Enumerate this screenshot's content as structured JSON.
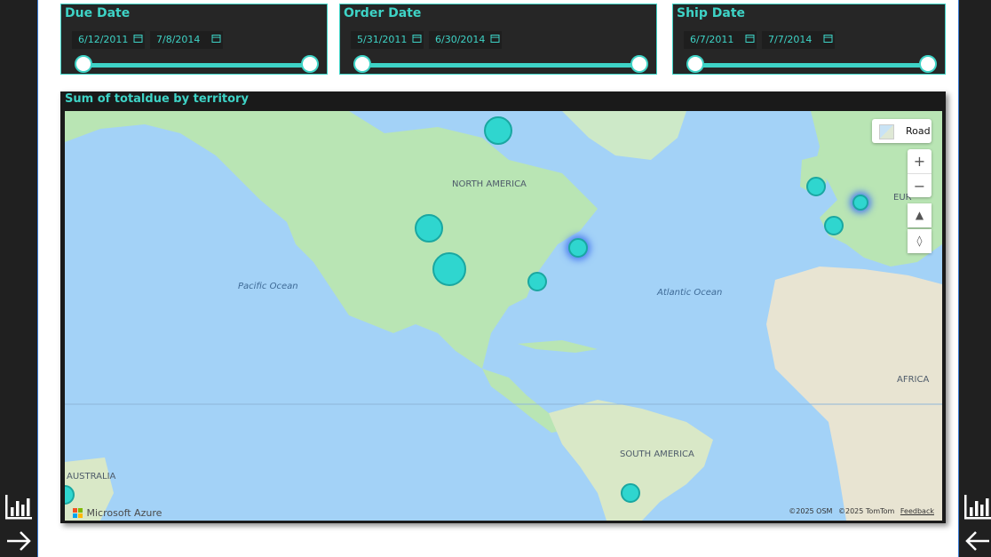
{
  "colors": {
    "accent": "#3ed3c6",
    "panel": "#262626",
    "ocean": "#a3d2f7",
    "land": "#b9e5b4",
    "bubble": "#2fd6cf",
    "selected_glow": "#4c7df0"
  },
  "slicers": [
    {
      "title": "Due Date",
      "start": "6/12/2011",
      "end": "7/8/2014",
      "icon": "calendar-icon"
    },
    {
      "title": "Order Date",
      "start": "5/31/2011",
      "end": "6/30/2014",
      "icon": "calendar-icon"
    },
    {
      "title": "Ship Date",
      "start": "6/7/2011",
      "end": "7/7/2014",
      "icon": "calendar-icon"
    }
  ],
  "map_visual": {
    "title": "Sum of totaldue by territory",
    "style_button": "Road",
    "zoom_in": "+",
    "zoom_out": "−",
    "labels": {
      "north_america": "NORTH AMERICA",
      "south_america": "SOUTH AMERICA",
      "europe": "EUR",
      "africa": "AFRICA",
      "australia": "AUSTRALIA",
      "pacific": "Pacific Ocean",
      "atlantic": "Atlantic Ocean"
    },
    "brand": "Microsoft Azure",
    "copyright_osm": "©2025 OSM",
    "copyright_tomtom": "©2025 TomTom",
    "feedback": "Feedback"
  },
  "rail_icons": {
    "report": "bar-chart-icon",
    "next": "arrow-right-icon",
    "back": "arrow-left-icon"
  }
}
